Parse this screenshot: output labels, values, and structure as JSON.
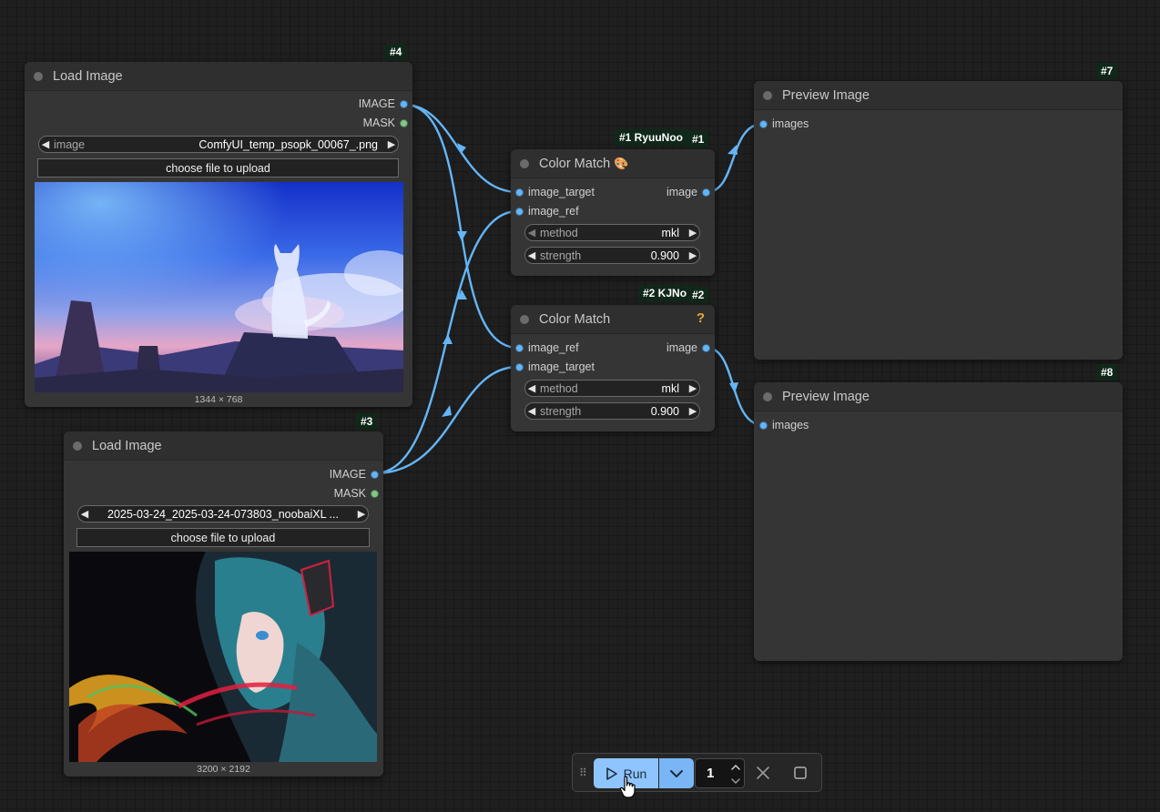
{
  "nodes": {
    "load_image_4": {
      "badge": "#4",
      "title": "Load Image",
      "outputs": [
        "IMAGE",
        "MASK"
      ],
      "image_combo": {
        "label": "image",
        "value": "ComfyUI_temp_psopk_00067_.png"
      },
      "upload_label": "choose file to upload",
      "dimensions": "1344 × 768"
    },
    "load_image_3": {
      "badge": "#3",
      "title": "Load Image",
      "outputs": [
        "IMAGE",
        "MASK"
      ],
      "image_combo": {
        "value": "2025-03-24_2025-03-24-073803_noobaiXL ..."
      },
      "upload_label": "choose file to upload",
      "dimensions": "3200 × 2192"
    },
    "color_match_1": {
      "badge_source": "#1 RyuuNoo",
      "badge_id": "#1",
      "title": "Color Match",
      "title_icon": "palette-emoji-icon",
      "inputs": [
        "image_target",
        "image_ref"
      ],
      "output": "image",
      "method": {
        "label": "method",
        "value": "mkl"
      },
      "strength": {
        "label": "strength",
        "value": "0.900"
      }
    },
    "color_match_2": {
      "badge_source": "#2 KJNo",
      "badge_id": "#2",
      "title": "Color Match",
      "title_mark": "?",
      "inputs": [
        "image_ref",
        "image_target"
      ],
      "output": "image",
      "method": {
        "label": "method",
        "value": "mkl"
      },
      "strength": {
        "label": "strength",
        "value": "0.900"
      }
    },
    "preview_image_7": {
      "badge": "#7",
      "title": "Preview Image",
      "input": "images"
    },
    "preview_image_8": {
      "badge": "#8",
      "title": "Preview Image",
      "input": "images"
    }
  },
  "toolbar": {
    "run_label": "Run",
    "batch_count": "1",
    "icons": [
      "drag-handle-icon",
      "play-icon",
      "chevron-down-icon",
      "chevron-up-icon",
      "close-icon",
      "stop-icon"
    ]
  },
  "colors": {
    "link": "#64b5f6",
    "image_slot": "#64b5f6",
    "mask_slot": "#81c784",
    "badge_bg": "#10281a",
    "run_button": "#8ec5ff",
    "node_bg": "#353535",
    "canvas_bg": "#1f1f1f"
  }
}
